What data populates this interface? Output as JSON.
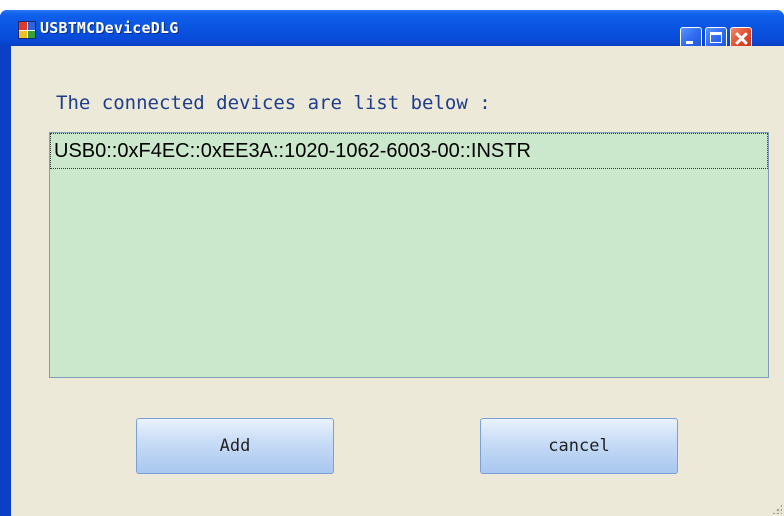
{
  "window": {
    "title": "USBTMCDeviceDLG",
    "icon": "app-window-icon",
    "controls": [
      "minimize-icon",
      "maximize-icon",
      "close-icon"
    ]
  },
  "dialog": {
    "heading": "The connected devices are list below :",
    "devices": [
      "USB0::0xF4EC::0xEE3A::1020-1062-6003-00::INSTR"
    ],
    "buttons": {
      "add_label": "Add",
      "cancel_label": "cancel"
    }
  },
  "colors": {
    "titlebar": "#0a54e2",
    "client_bg": "#ece9d8",
    "listbox_bg": "#cce8cc",
    "heading_text": "#1f3d8a",
    "close_button": "#e04a2a"
  }
}
